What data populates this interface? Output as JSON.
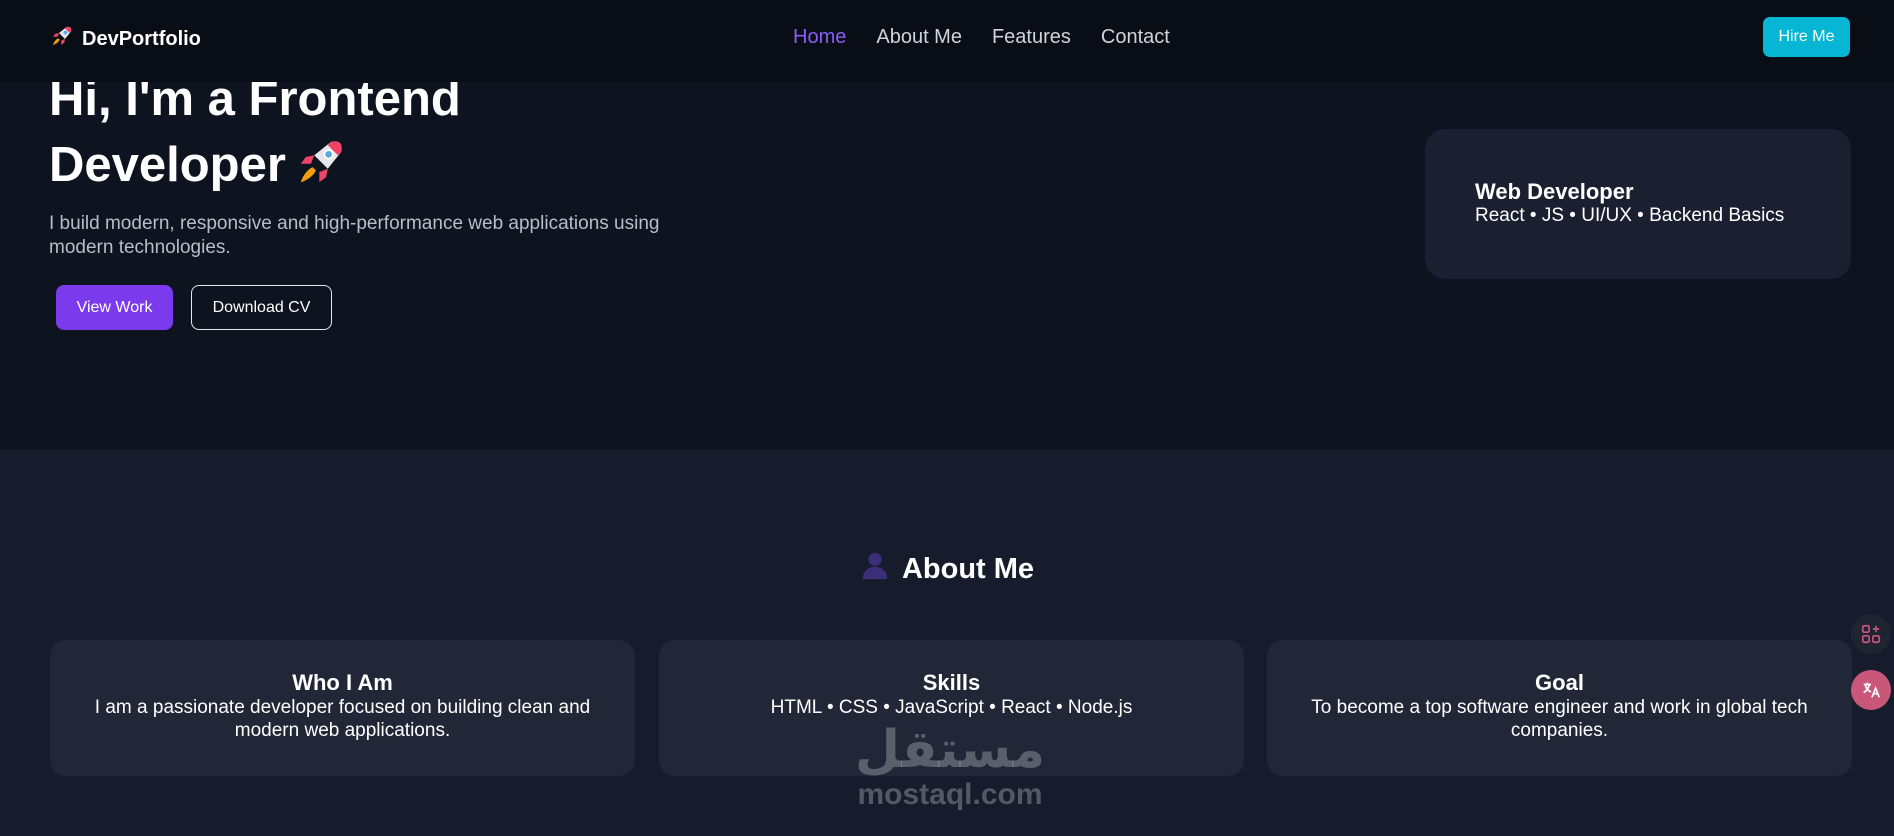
{
  "navbar": {
    "brand": "DevPortfolio",
    "brand_icon": "rocket-icon",
    "links": [
      {
        "label": "Home",
        "active": true
      },
      {
        "label": "About Me",
        "active": false
      },
      {
        "label": "Features",
        "active": false
      },
      {
        "label": "Contact",
        "active": false
      }
    ],
    "hire_button": "Hire Me"
  },
  "hero": {
    "title_line1": "Hi, I'm a Frontend",
    "title_line2": "Developer",
    "title_icon": "rocket-icon",
    "subtitle": "I build modern, responsive and high-performance web applications using modern technologies.",
    "primary_button": "View Work",
    "secondary_button": "Download CV",
    "card": {
      "title": "Web Developer",
      "text": "React • JS • UI/UX • Backend Basics"
    }
  },
  "about": {
    "heading": "About Me",
    "heading_icon": "person-icon",
    "cards": [
      {
        "title": "Who I Am",
        "text": "I am a passionate developer focused on building clean and modern web applications."
      },
      {
        "title": "Skills",
        "text": "HTML • CSS • JavaScript • React • Node.js"
      },
      {
        "title": "Goal",
        "text": "To become a top software engineer and work in global tech companies."
      }
    ]
  },
  "watermark": {
    "arabic": "مستقل",
    "latin": "mostaql.com"
  },
  "colors": {
    "accent": "#7c3aed",
    "active_link": "#8b5cf6",
    "hire": "#06b6d4",
    "background": "#0e1320"
  },
  "side_widgets": [
    "apps-icon",
    "translate-icon"
  ]
}
